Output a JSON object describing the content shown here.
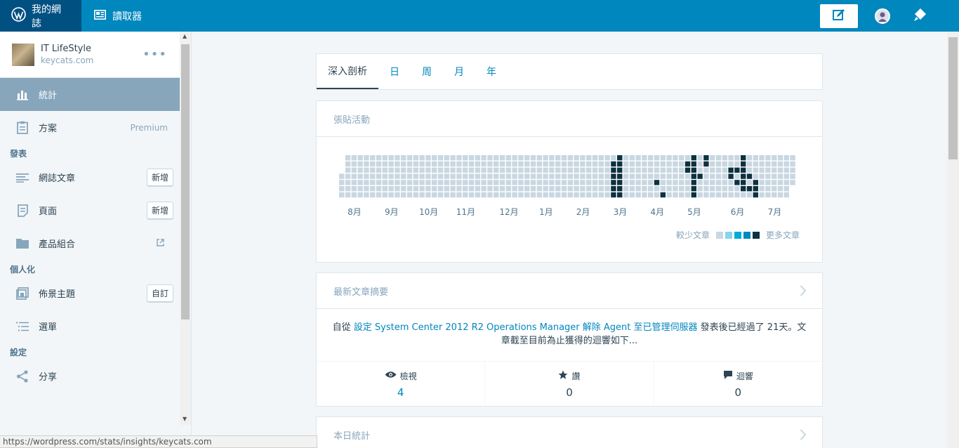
{
  "masterbar": {
    "my_site_label": "我的網誌",
    "reader_label": "讀取器",
    "icons": [
      "wordpress-logo-icon",
      "reader-icon",
      "write-icon",
      "avatar",
      "notifications-icon"
    ]
  },
  "site": {
    "name": "IT LifeStyle",
    "domain": "keycats.com",
    "more": "•••"
  },
  "sidebar": {
    "stats_label": "統計",
    "plans_label": "方案",
    "plans_badge": "Premium",
    "publish_heading": "發表",
    "posts_label": "網誌文章",
    "posts_add": "新增",
    "pages_label": "頁面",
    "pages_add": "新增",
    "portfolio_label": "產品組合",
    "personalize_heading": "個人化",
    "themes_label": "佈景主題",
    "themes_customize": "自訂",
    "menus_label": "選單",
    "settings_heading": "設定",
    "sharing_label": "分享"
  },
  "tabs": [
    {
      "label": "深入剖析",
      "active": true
    },
    {
      "label": "日",
      "active": false
    },
    {
      "label": "周",
      "active": false
    },
    {
      "label": "月",
      "active": false
    },
    {
      "label": "年",
      "active": false
    }
  ],
  "post_activity": {
    "title": "張貼活動",
    "months": [
      "8月",
      "9月",
      "10月",
      "11月",
      "12月",
      "1月",
      "2月",
      "3月",
      "4月",
      "5月",
      "6月",
      "7月"
    ],
    "legend_less": "較少文章",
    "legend_more": "更多文章",
    "legend_colors": [
      "#c8d7e1",
      "#8ad3ee",
      "#00aadc",
      "#0087be",
      "#0d3141"
    ]
  },
  "latest_post": {
    "title": "最新文章摘要",
    "prefix": "自從",
    "post_title": "設定 System Center 2012 R2 Operations Manager 解除 Agent 至已管理伺服器",
    "suffix": "發表後已經過了 21天。文章截至目前為止獲得的迴響如下...",
    "views_label": "檢視",
    "views": "4",
    "likes_label": "讚",
    "likes": "0",
    "comments_label": "迴響",
    "comments": "0"
  },
  "today_stats": {
    "title": "本日統計"
  },
  "statusbar": {
    "url": "https://wordpress.com/stats/insights/keycats.com"
  }
}
